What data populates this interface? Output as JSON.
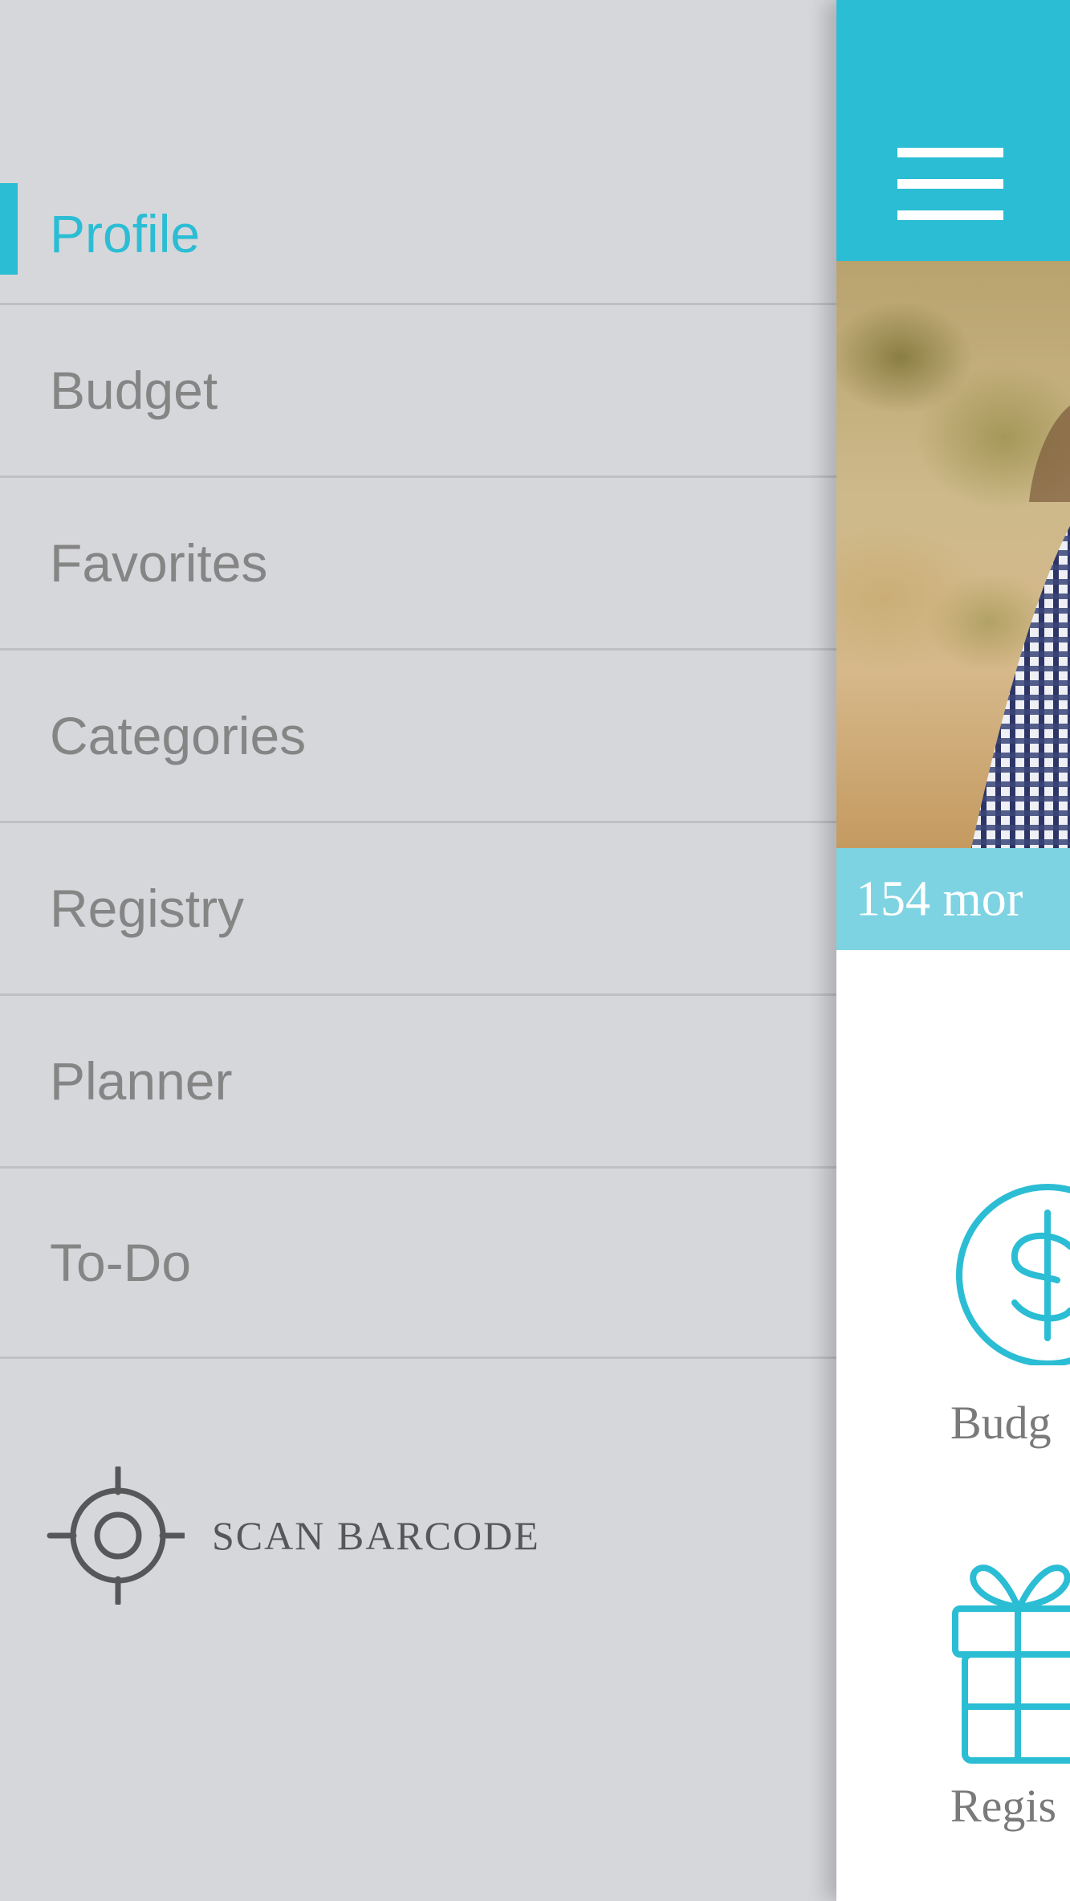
{
  "drawer": {
    "items": [
      {
        "label": "Profile",
        "active": true
      },
      {
        "label": "Budget",
        "active": false
      },
      {
        "label": "Favorites",
        "active": false
      },
      {
        "label": "Categories",
        "active": false
      },
      {
        "label": "Registry",
        "active": false
      },
      {
        "label": "Planner",
        "active": false
      },
      {
        "label": "To-Do",
        "active": false
      }
    ],
    "scan": {
      "label": "SCAN BARCODE",
      "icon": "crosshair-icon"
    }
  },
  "main": {
    "header": {
      "menu_icon": "hamburger-icon"
    },
    "photo_caption": "154 mor",
    "tiles": [
      {
        "label": "Budg",
        "icon": "dollar-icon"
      },
      {
        "label": "Regis",
        "icon": "gift-icon"
      }
    ]
  },
  "colors": {
    "accent": "#2bbdd4",
    "drawer_bg": "#d6d7db",
    "menu_text": "#858585",
    "caption_bg": "#7dd3e1"
  }
}
